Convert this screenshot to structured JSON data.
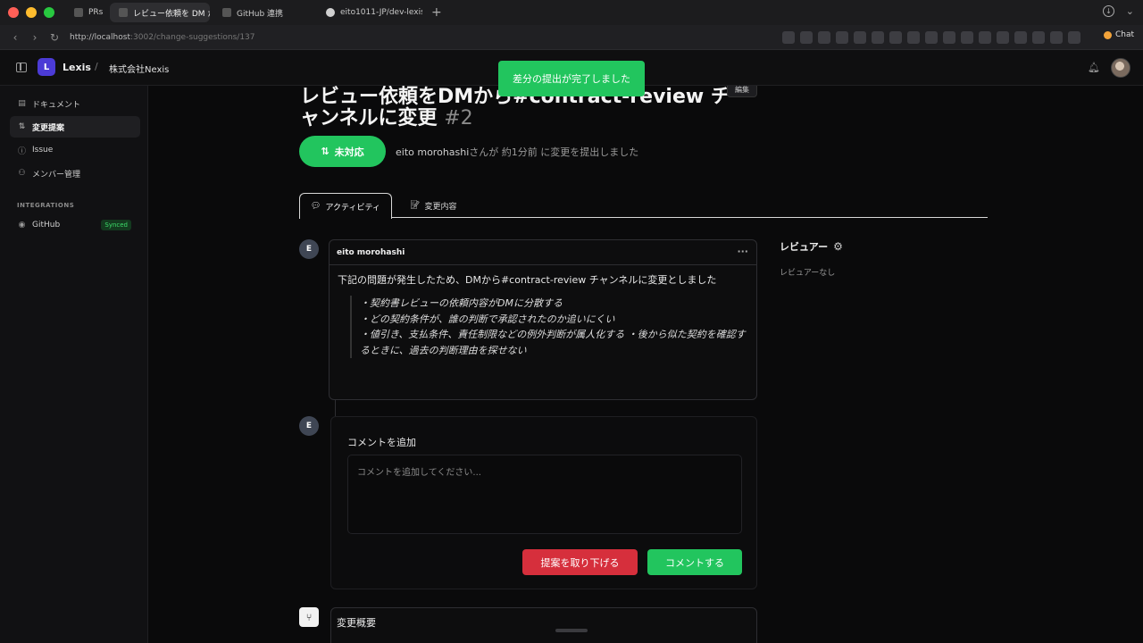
{
  "browser": {
    "tabs": [
      {
        "label": "PRs",
        "active": false
      },
      {
        "label": "レビュー依頼を DM から#",
        "active": true
      },
      {
        "label": "GitHub 連携",
        "active": false
      },
      {
        "label": "eito1011-JP/dev-lexis",
        "active": false
      }
    ],
    "url_host": "http://localhost",
    "url_path": ":3002/change-suggestions/137",
    "chat_label": "Chat"
  },
  "header": {
    "logo_letter": "L",
    "brand": "Lexis",
    "separator": "/",
    "org": "株式会社Nexis"
  },
  "sidebar": {
    "items": [
      {
        "label": "ドキュメント",
        "icon": "document-icon"
      },
      {
        "label": "変更提案",
        "icon": "pull-request-icon"
      },
      {
        "label": "Issue",
        "icon": "issue-icon"
      },
      {
        "label": "メンバー管理",
        "icon": "users-icon"
      }
    ],
    "section": "INTEGRATIONS",
    "github": {
      "label": "GitHub",
      "badge": "Synced"
    }
  },
  "suggestion": {
    "title_line1": "レビュー依頼をDMから#contract-review チ",
    "title_line2": "ャンネルに変更",
    "number": "#2",
    "edit_label": "編集",
    "status": "未対応",
    "author": "eito morohashi",
    "meta_suffix": "さんが 約1分前 に変更を提出しました"
  },
  "tabs": {
    "activity": "アクティビティ",
    "changes": "変更内容"
  },
  "comment": {
    "avatar_letter": "E",
    "author": "eito morohashi",
    "more": "···",
    "body": "下記の問題が発生したため、DMから#contract-review チャンネルに変更としました",
    "quote_line1": "・契約書レビューの依頼内容がDMに分散する",
    "quote_line2": "・どの契約条件が、誰の判断で承認されたのか追いにくい",
    "quote_line3": "・値引き、支払条件、責任制限などの例外判断が属人化する ・後から似た契約を確認するときに、過去の判断理由を探せない"
  },
  "add_comment": {
    "avatar_letter": "E",
    "title": "コメントを追加",
    "placeholder": "コメントを追加してください...",
    "withdraw_label": "提案を取り下げる",
    "submit_label": "コメントする"
  },
  "summary": {
    "title": "変更概要"
  },
  "reviewers": {
    "title": "レビュアー",
    "empty": "レビュアーなし"
  },
  "toast": {
    "message": "差分の提出が完了しました"
  },
  "colors": {
    "accent_green": "#22c55e",
    "danger_red": "#d62f3c",
    "logo_purple": "#4b3bd6"
  }
}
